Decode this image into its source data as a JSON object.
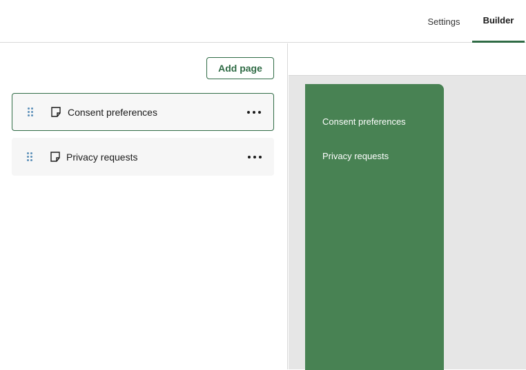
{
  "tabs": {
    "settings": "Settings",
    "builder": "Builder"
  },
  "sidebar": {
    "add_page_label": "Add page",
    "pages": [
      {
        "label": "Consent preferences",
        "selected": true
      },
      {
        "label": "Privacy requests",
        "selected": false
      }
    ]
  },
  "preview": {
    "nav_links": [
      "Consent preferences",
      "Privacy requests"
    ]
  },
  "colors": {
    "accent": "#2f6b45",
    "nav_panel": "#488253",
    "drag_handle": "#5b8fb8"
  }
}
